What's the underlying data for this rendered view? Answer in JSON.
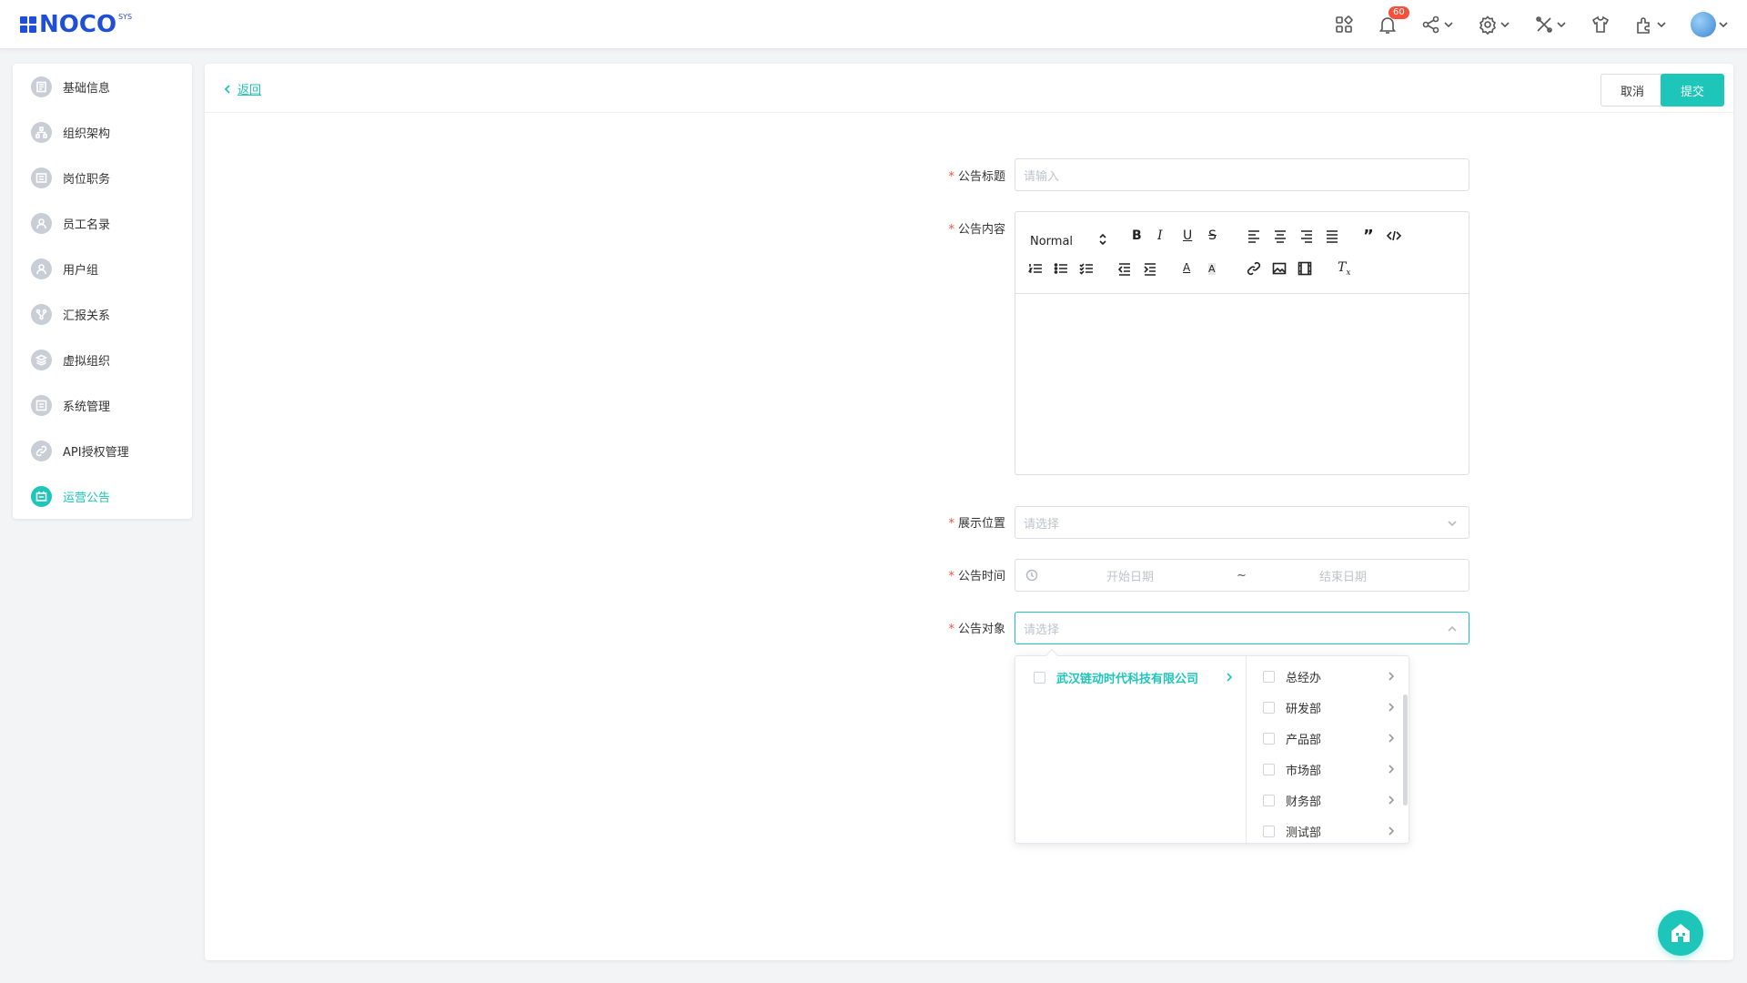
{
  "brand": {
    "name": "NOCO",
    "sup": "SYS"
  },
  "colors": {
    "accent": "#1ec6b9",
    "brand": "#1e4fd6",
    "badge": "#f5503b"
  },
  "topbar": {
    "notification_count": "60",
    "icons": [
      "apps-icon",
      "bell-icon",
      "share-icon",
      "settings-icon",
      "tools-icon",
      "shirt-icon",
      "plugin-icon",
      "avatar"
    ]
  },
  "sidebar": {
    "items": [
      {
        "label": "基础信息",
        "icon": "document-icon"
      },
      {
        "label": "组织架构",
        "icon": "org-tree-icon"
      },
      {
        "label": "岗位职务",
        "icon": "badge-icon"
      },
      {
        "label": "员工名录",
        "icon": "contacts-icon"
      },
      {
        "label": "用户组",
        "icon": "user-group-icon"
      },
      {
        "label": "汇报关系",
        "icon": "relation-icon"
      },
      {
        "label": "虚拟组织",
        "icon": "layers-icon"
      },
      {
        "label": "系统管理",
        "icon": "system-icon"
      },
      {
        "label": "API授权管理",
        "icon": "link-icon"
      },
      {
        "label": "运营公告",
        "icon": "announcement-icon",
        "active": true
      }
    ]
  },
  "header": {
    "back_label": "返回",
    "cancel_label": "取消",
    "submit_label": "提交"
  },
  "form": {
    "title": {
      "label": "公告标题",
      "placeholder": "请输入"
    },
    "content": {
      "label": "公告内容",
      "font_size_select": "Normal"
    },
    "position": {
      "label": "展示位置",
      "placeholder": "请选择"
    },
    "time": {
      "label": "公告时间",
      "start_placeholder": "开始日期",
      "separator": "~",
      "end_placeholder": "结束日期"
    },
    "target": {
      "label": "公告对象",
      "placeholder": "请选择"
    }
  },
  "cascader": {
    "level1": [
      {
        "label": "武汉链动时代科技有限公司"
      }
    ],
    "level2": [
      {
        "label": "总经办"
      },
      {
        "label": "研发部"
      },
      {
        "label": "产品部"
      },
      {
        "label": "市场部"
      },
      {
        "label": "财务部"
      },
      {
        "label": "测试部"
      }
    ]
  }
}
